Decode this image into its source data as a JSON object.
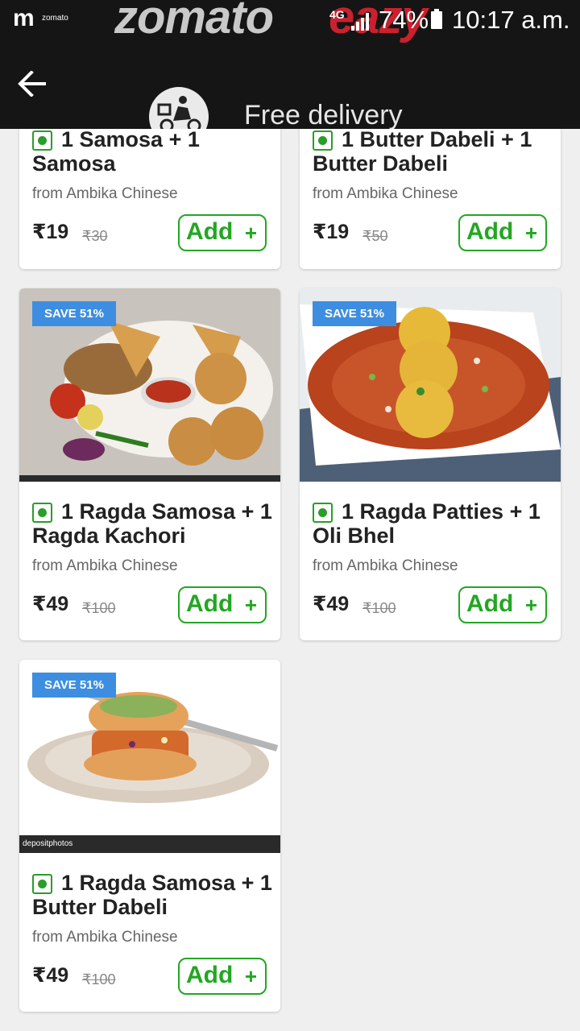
{
  "status_bar": {
    "app_name": "zomato",
    "brand_part1": "zomato",
    "brand_part2": "eazy",
    "network": "4G",
    "battery": "74%",
    "time": "10:17 a.m."
  },
  "header": {
    "free_delivery": "Free delivery"
  },
  "colors": {
    "veg": "#2a9d2a",
    "add": "#22a722",
    "badge": "#3d8ee0",
    "brand_red": "#cb202d"
  },
  "items": [
    {
      "title": "1 Samosa + 1 Samosa",
      "restaurant": "from Ambika Chinese",
      "price": "₹19",
      "mrp": "₹30",
      "add_label": "Add",
      "add_plus": "+"
    },
    {
      "title": "1 Butter Dabeli + 1 Butter Dabeli",
      "restaurant": "from Ambika Chinese",
      "price": "₹19",
      "mrp": "₹50",
      "add_label": "Add",
      "add_plus": "+"
    },
    {
      "badge": "SAVE 51%",
      "title": "1 Ragda Samosa + 1 Ragda Kachori",
      "restaurant": "from Ambika Chinese",
      "price": "₹49",
      "mrp": "₹100",
      "add_label": "Add",
      "add_plus": "+"
    },
    {
      "badge": "SAVE 51%",
      "title": "1 Ragda Patties + 1 Oli Bhel",
      "restaurant": "from Ambika Chinese",
      "price": "₹49",
      "mrp": "₹100",
      "add_label": "Add",
      "add_plus": "+"
    },
    {
      "badge": "SAVE 51%",
      "title": "1 Ragda Samosa + 1 Butter Dabeli",
      "restaurant": "from Ambika Chinese",
      "price": "₹49",
      "mrp": "₹100",
      "add_label": "Add",
      "add_plus": "+",
      "watermark": "depositphotos"
    }
  ]
}
